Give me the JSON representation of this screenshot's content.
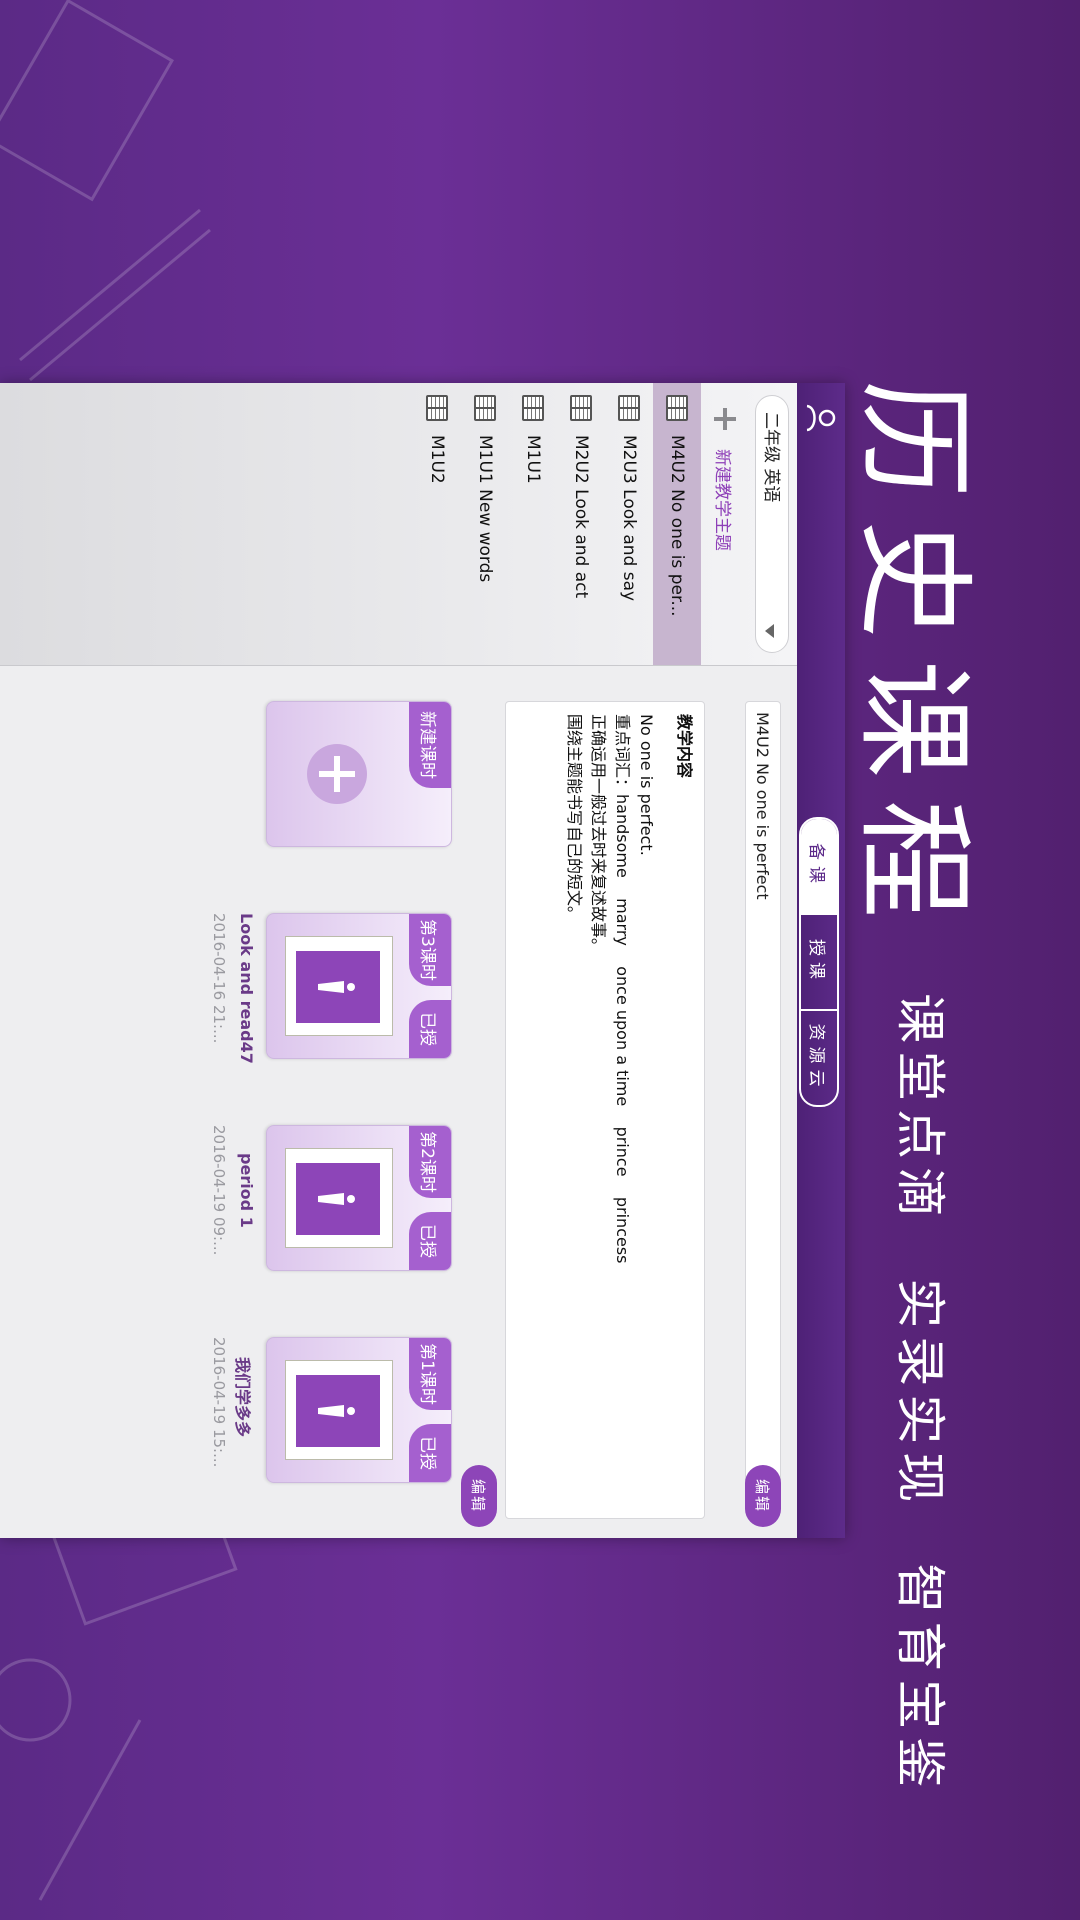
{
  "headline": {
    "title": "历史课程",
    "slogans": [
      "课堂点滴",
      "实录实现",
      "智育宝鉴"
    ]
  },
  "header": {
    "tabs": [
      {
        "label": "备课"
      },
      {
        "label": "授课"
      },
      {
        "label": "资源云"
      }
    ]
  },
  "sidebar": {
    "grade_select": "二年级 英语",
    "new_topic_label": "新建教学主题",
    "items": [
      {
        "label": "M4U2 No one is per..."
      },
      {
        "label": "M2U3 Look and say"
      },
      {
        "label": "M2U2 Look and act"
      },
      {
        "label": "M1U1"
      },
      {
        "label": "M1U1 New words"
      },
      {
        "label": "M1U2"
      }
    ]
  },
  "main": {
    "title_value": "M4U2 No one is perfect",
    "edit_label": "编辑",
    "desc": {
      "heading": "教学内容",
      "lines": [
        "No one is perfect.",
        "重点词汇：handsome    marry    once upon a time    prince    princess",
        "正确运用一般过去时来复述故事。",
        "围绕主题能书写自己的短文。"
      ]
    },
    "lessons_edit_label": "编辑",
    "new_lesson_label": "新建课时",
    "lessons": [
      {
        "period": "第3课时",
        "status": "已授",
        "name": "Look and read47",
        "date": "2016-04-16 21:..."
      },
      {
        "period": "第2课时",
        "status": "已授",
        "name": "period 1",
        "date": "2016-04-19 09:..."
      },
      {
        "period": "第1课时",
        "status": "已授",
        "name": "我们学多多",
        "date": "2016-04-19 15:..."
      }
    ]
  }
}
